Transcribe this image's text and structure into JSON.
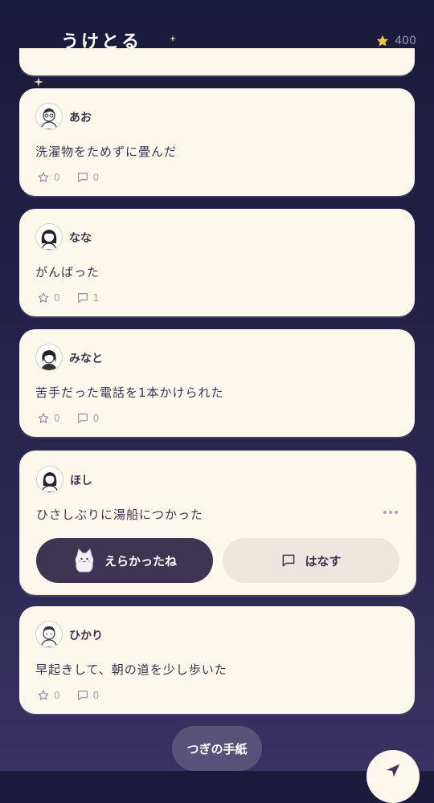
{
  "header": {
    "title": "うけとる",
    "coin_count": "400",
    "coin_icon": "star-icon"
  },
  "posts": [
    {
      "name": "あお",
      "text": "洗濯物をためずに畳んだ",
      "stars": "0",
      "comments": "0"
    },
    {
      "name": "なな",
      "text": "がんばった",
      "stars": "0",
      "comments": "1"
    },
    {
      "name": "みなと",
      "text": "苦手だった電話を1本かけられた",
      "stars": "0",
      "comments": "0"
    },
    {
      "name": "ほし",
      "text": "ひさしぶりに湯船につかった",
      "praise_label": "えらかったね",
      "talk_label": "はなす"
    },
    {
      "name": "ひかり",
      "text": "早起きして、朝の道を少し歩いた",
      "stars": "0",
      "comments": "0"
    }
  ],
  "footer": {
    "next_label": "つぎの手紙"
  },
  "colors": {
    "card_bg": "#fdf8ec",
    "primary": "#3e3552",
    "accent_star": "#f5c244"
  }
}
